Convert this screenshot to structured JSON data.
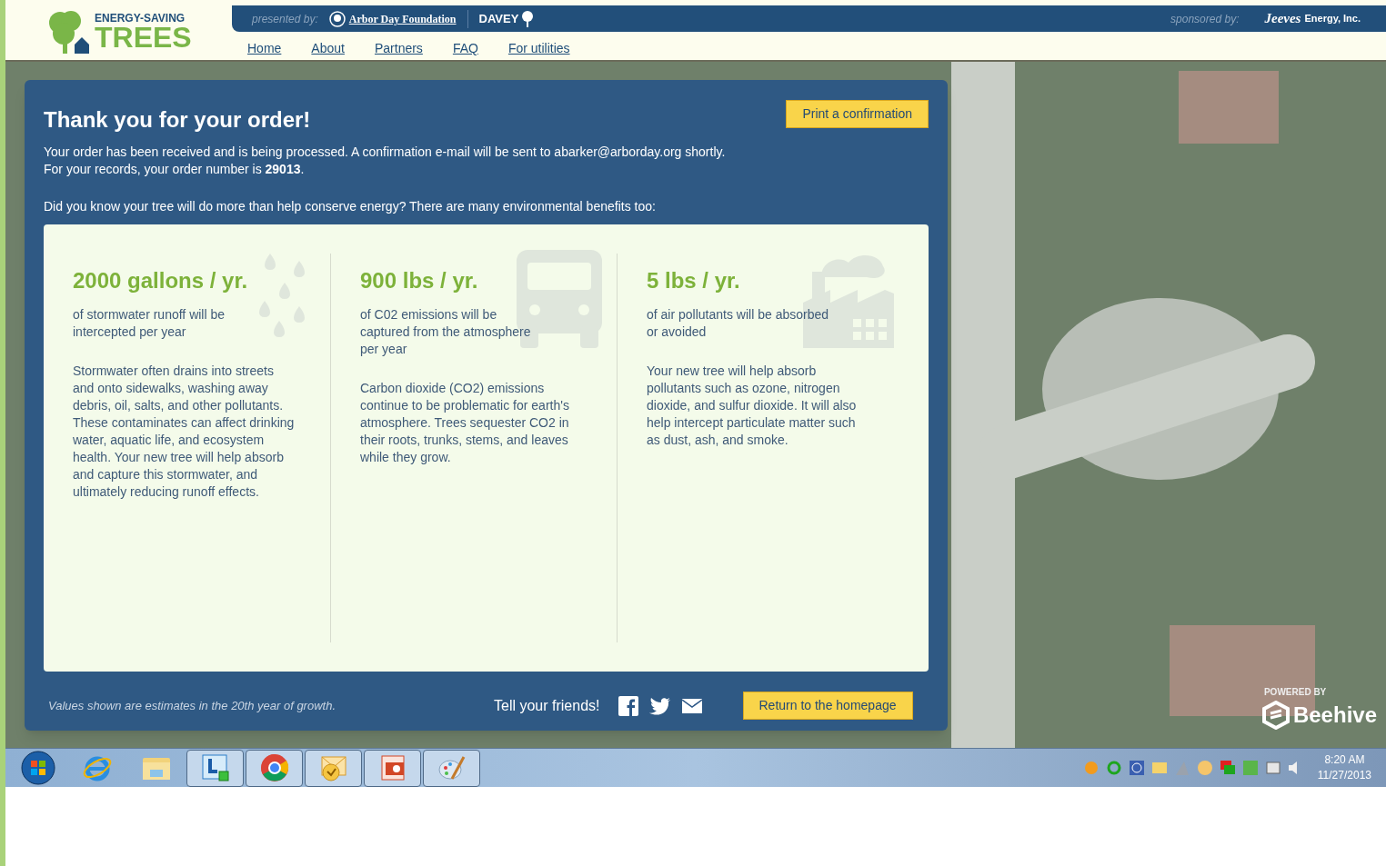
{
  "header": {
    "logo": {
      "line1": "ENERGY-SAVING",
      "line2": "TREES"
    },
    "presented_by": "presented by:",
    "partners": [
      "Arbor Day Foundation",
      "DAVEY"
    ],
    "sponsored_by": "sponsored by:",
    "sponsor": {
      "script": "Jeeves",
      "name": "Energy, Inc."
    }
  },
  "nav": [
    "Home",
    "About",
    "Partners",
    "FAQ",
    "For utilities"
  ],
  "order": {
    "title": "Thank you for your order!",
    "print_button": "Print a confirmation",
    "message": [
      "Your order has been received and is being processed. A confirmation e-mail will be sent to abarker@arborday.org shortly.",
      "For your records, your order number is **29013**."
    ],
    "intro": "Did you know your tree will do more than help conserve energy? There are many environmental benefits too:"
  },
  "benefits": [
    {
      "kind": "water",
      "stat": "2000 gallons / yr.",
      "summary": "of stormwater runoff will be intercepted per year",
      "detail": "Stormwater often drains into streets and onto sidewalks, washing away debris, oil, salts, and other pollutants. These contaminates can affect drinking water, aquatic life, and ecosystem health. Your new tree will help absorb and capture this stormwater, and ultimately reducing runoff effects."
    },
    {
      "kind": "truck",
      "stat": "900 lbs / yr.",
      "summary": "of C02 emissions will be captured from the atmosphere per year",
      "detail": "Carbon dioxide (CO2) emissions continue to be problematic for earth's atmosphere. Trees sequester CO2 in their roots, trunks, stems, and leaves while they grow."
    },
    {
      "kind": "factory",
      "stat": "5 lbs / yr.",
      "summary": "of air pollutants will be absorbed or avoided",
      "detail": "Your new tree will help absorb pollutants such as ozone, nitrogen dioxide, and sulfur dioxide. It will also help intercept particulate matter such as dust, ash, and smoke."
    }
  ],
  "footer": {
    "note": "Values shown are estimates in the 20th year of growth.",
    "share_label": "Tell your friends!",
    "return_button": "Return to the homepage"
  },
  "branding": {
    "powered_by": "POWERED BY",
    "name": "Beehive"
  },
  "taskbar": {
    "apps": [
      {
        "kind": "start",
        "running": false
      },
      {
        "kind": "browser",
        "running": false
      },
      {
        "kind": "folder",
        "running": false
      },
      {
        "kind": "chat",
        "running": true
      },
      {
        "kind": "chrome",
        "running": true
      },
      {
        "kind": "mail",
        "running": true
      },
      {
        "kind": "slides",
        "running": true
      },
      {
        "kind": "paint",
        "running": true
      }
    ],
    "clock": {
      "time": "8:20 AM",
      "date": "11/27/2013"
    }
  }
}
